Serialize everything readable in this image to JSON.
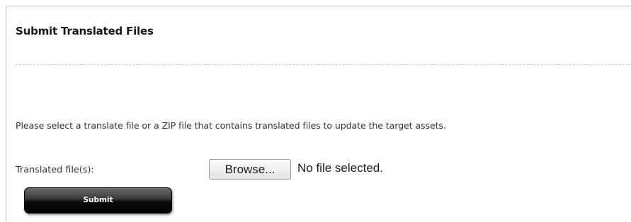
{
  "panel": {
    "title": "Submit Translated Files",
    "instructions": "Please select a translate file or a ZIP file that contains translated files to update the target assets."
  },
  "form": {
    "file_label": "Translated file(s):",
    "browse_label": "Browse...",
    "file_status": "No file selected.",
    "submit_label": "Submit"
  }
}
